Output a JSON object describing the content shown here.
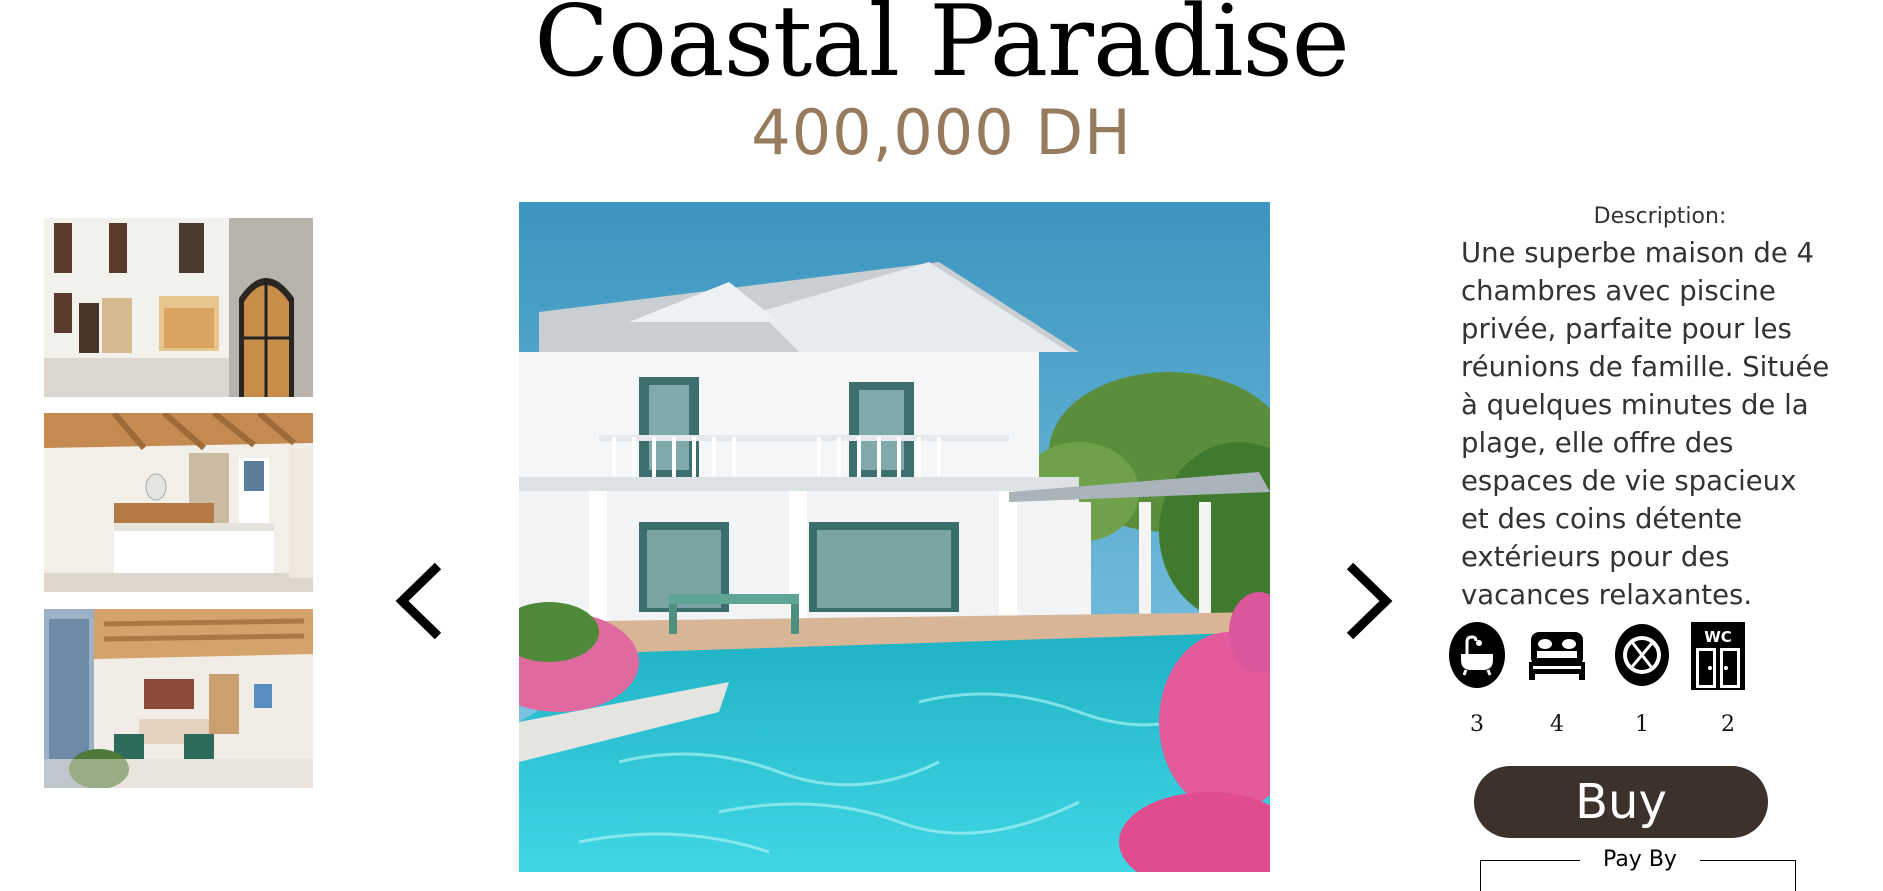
{
  "listing": {
    "title": "Coastal Paradise",
    "price": "400,000 DH"
  },
  "gallery": {
    "thumbnails": [
      {
        "name": "thumbnail-facade"
      },
      {
        "name": "thumbnail-bedroom"
      },
      {
        "name": "thumbnail-living-room"
      }
    ],
    "main_image": "main-photo-house-with-pool",
    "prev_icon": "chevron-left-icon",
    "next_icon": "chevron-right-icon"
  },
  "description": {
    "label": "Description:",
    "lines": [
      "Une superbe maison de 4",
      "chambres avec piscine",
      "privée, parfaite pour les",
      "réunions de famille. Située",
      "à quelques minutes de la",
      "plage, elle offre des",
      "espaces de vie spacieux",
      "et des coins détente",
      "extérieurs pour des",
      "vacances relaxantes."
    ]
  },
  "amenities": [
    {
      "icon": "bathtub-icon",
      "count": "3"
    },
    {
      "icon": "bed-icon",
      "count": "4"
    },
    {
      "icon": "dining-icon",
      "count": "1"
    },
    {
      "icon": "wc-icon",
      "count": "2"
    }
  ],
  "actions": {
    "buy_label": "Buy",
    "pay_by_label": "Pay By"
  },
  "colors": {
    "price": "#967b5e",
    "buy_button": "#3d312b"
  }
}
